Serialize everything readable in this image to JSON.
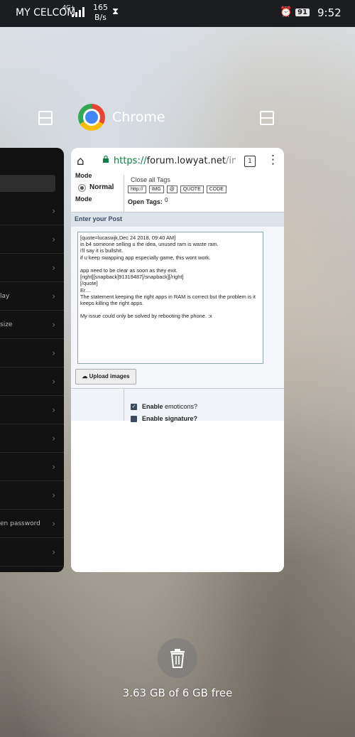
{
  "status_bar": {
    "carrier": "MY CELCOM",
    "network": "4G+",
    "speed_value": "165",
    "speed_unit": "B/s",
    "battery": "91",
    "time": "9:52"
  },
  "recents": {
    "app_name": "Chrome",
    "memory": "3.63 GB of 6 GB free"
  },
  "left_card": {
    "items": [
      "",
      "",
      "",
      "",
      "lay",
      "size",
      "",
      "",
      "",
      "",
      "",
      "",
      "en password",
      ""
    ]
  },
  "chrome": {
    "url_scheme": "https://",
    "url_host": "forum.lowyat.net",
    "url_path": "/index.p",
    "tab_count": "1"
  },
  "forum": {
    "mode_label_top": "Mode",
    "radio_label": "Normal",
    "mode_label_bottom": "Mode",
    "close_all_tags": "Close all Tags",
    "tag_buttons": [
      "http://",
      "IMG",
      "@",
      "QUOTE",
      "CODE"
    ],
    "open_tags_label": "Open Tags:",
    "open_tags_value": "0",
    "section_header": "Enter your Post",
    "post_text": "[quote=lucaswjk,Dec 24 2018, 09:40 AM]\nin b4 someone selling u the idea, unused ram is waste ram.\ni'll say it is bullshit.\nif u keep swapping app especially game, this wont work.\n\napp need to be clear as soon as they exit.\n[right][snapback]91319487[/snapback][/right]\n[/quote]\nEr....\nThe statement keeping the right apps in RAM is correct but the problem is it keeps killing the right apps.\n\nMy issue could only be solved by rebooting the phone. :x",
    "upload_label": "Upload images",
    "enable_emoticons_bold": "Enable",
    "enable_emoticons_rest": " emoticons?",
    "enable_signature": "Enable signature?"
  }
}
